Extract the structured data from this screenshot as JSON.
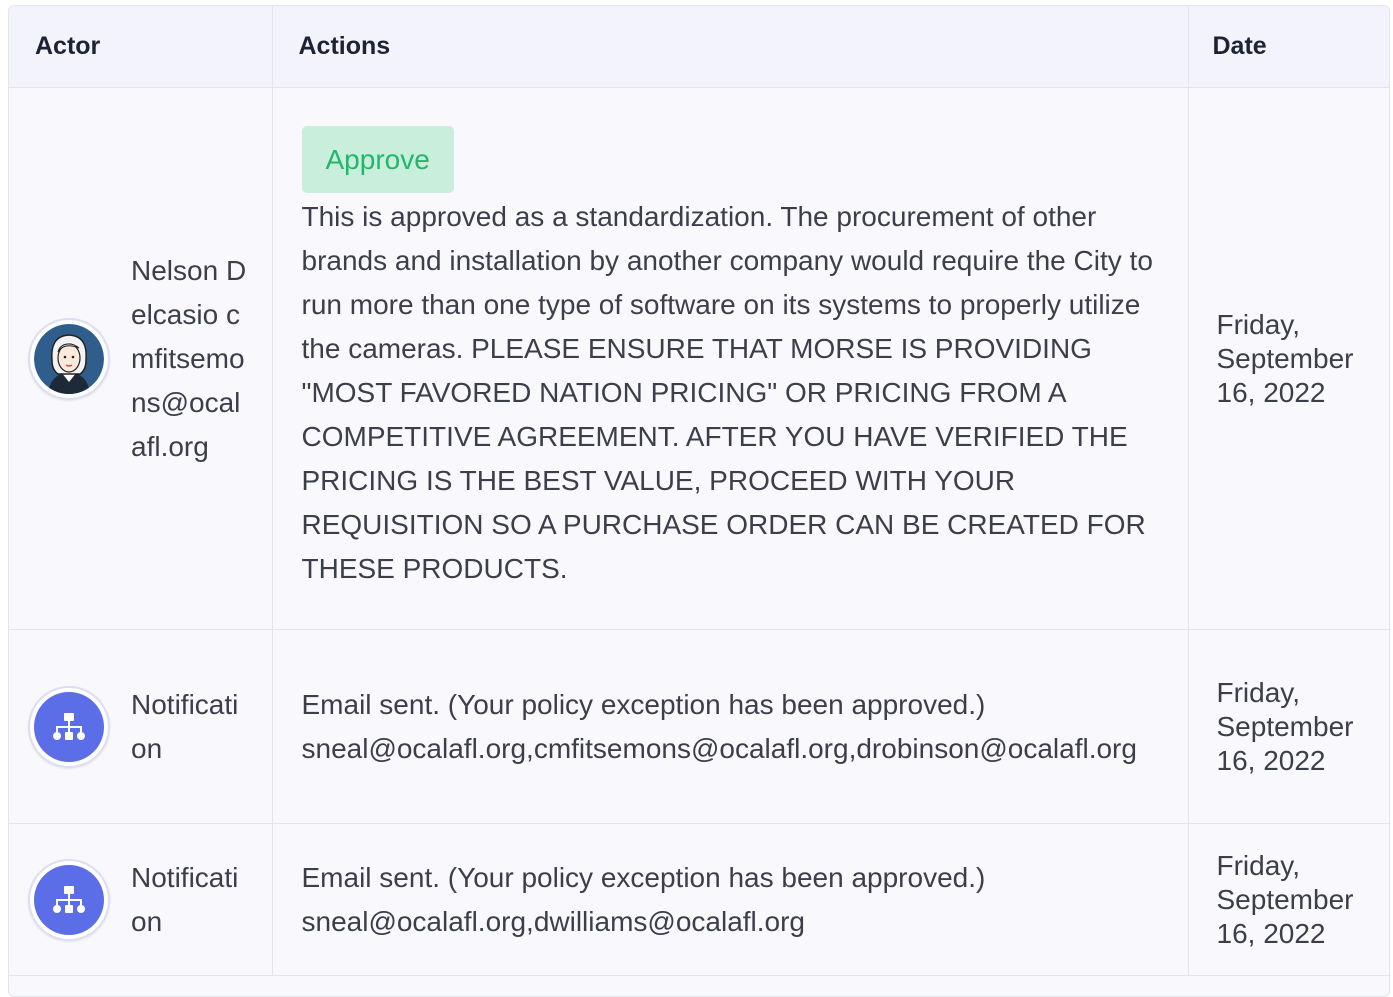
{
  "table": {
    "headers": [
      "Actor",
      "Actions",
      "Date"
    ],
    "rows": [
      {
        "actor": "Nelson Delcasio cmfitsemons@ocalafl.org",
        "avatar_icon": "woman-portrait-icon",
        "badge": "Approve",
        "text": "This is approved as a standardization.  The procurement of other brands and installation by another company would require the City to run more than one type of software on its systems to properly utilize the cameras.  PLEASE ENSURE THAT MORSE IS PROVIDING \"MOST FAVORED NATION PRICING\" OR PRICING FROM A COMPETITIVE AGREEMENT.  AFTER YOU HAVE VERIFIED THE PRICING IS THE BEST VALUE, PROCEED WITH YOUR REQUISITION SO A PURCHASE ORDER CAN BE CREATED FOR THESE PRODUCTS.",
        "date": "Friday, September 16, 2022"
      },
      {
        "actor": "Notification",
        "avatar_icon": "org-chart-icon",
        "line1": "Email sent. (Your policy exception has been approved.)",
        "line2": "sneal@ocalafl.org,cmfitsemons@ocalafl.org,drobinson@ocalafl.org",
        "date": "Friday, September 16, 2022"
      },
      {
        "actor": "Notification",
        "avatar_icon": "org-chart-icon",
        "line1": "Email sent. (Your policy exception has been approved.)",
        "line2": "sneal@ocalafl.org,dwilliams@ocalafl.org",
        "date": "Friday, September 16, 2022"
      }
    ]
  },
  "colors": {
    "approve_badge_bg": "#c9eedb",
    "approve_badge_text": "#20b86a",
    "notification_avatar": "#5b6ee8",
    "header_bg": "#f2f3fb"
  }
}
